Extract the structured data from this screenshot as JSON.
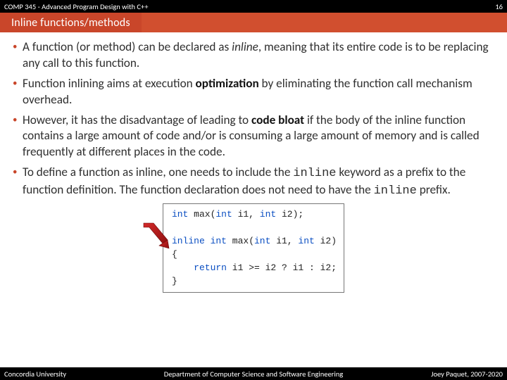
{
  "header": {
    "course": "COMP 345 - Advanced Program Design with C++",
    "page_num": "16",
    "slide_title": "Inline functions/methods"
  },
  "bullets": {
    "b1_pre": "A function (or method) can be declared as ",
    "b1_kw": "inline",
    "b1_post": ", meaning that its entire code is to be replacing any call to this function.",
    "b2_pre": "Function inlining aims at execution ",
    "b2_kw": "optimization",
    "b2_post": " by eliminating the function call mechanism overhead.",
    "b3_pre": "However, it has the disadvantage of leading to ",
    "b3_kw": "code bloat",
    "b3_post": " if the body of the inline function contains a large amount of code and/or is consuming a large amount of memory and is called frequently at different places in the code.",
    "b4_pre": "To define a function as inline, one needs to include the ",
    "b4_kw": "inline",
    "b4_mid": " keyword as a prefix to the function definition. The function declaration does not need to have the ",
    "b4_kw2": "inline",
    "b4_post": " prefix."
  },
  "code": {
    "line1_kw": "int",
    "line1_rest": " max(",
    "line1_kw2": "int",
    "line1_mid": " i1, ",
    "line1_kw3": "int",
    "line1_end": " i2);",
    "blank": "",
    "line2_kw0": "inline",
    "line2_sp": " ",
    "line2_kw": "int",
    "line2_rest": " max(",
    "line2_kw2": "int",
    "line2_mid": " i1, ",
    "line2_kw3": "int",
    "line2_end": " i2)",
    "brace_open": "{",
    "ret_indent": "    ",
    "ret_kw": "return",
    "ret_rest": " i1 >= i2 ? i1 : i2;",
    "brace_close": "}"
  },
  "footer": {
    "left": "Concordia University",
    "mid": "Department of Computer Science and Software Engineering",
    "right": "Joey Paquet, 2007-2020"
  }
}
